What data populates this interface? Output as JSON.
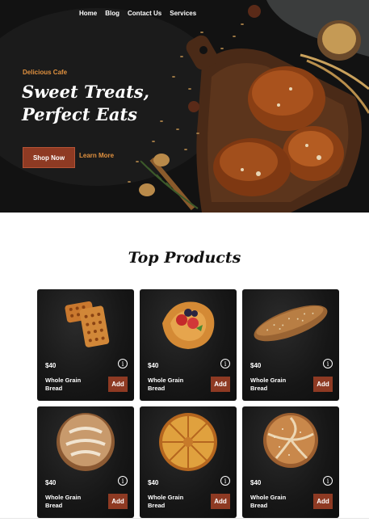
{
  "nav": {
    "items": [
      "Home",
      "Blog",
      "Contact Us",
      "Services"
    ]
  },
  "hero": {
    "eyebrow": "Delicious Cafe",
    "headline_line1": "Sweet Treats,",
    "headline_line2": "Perfect Eats",
    "primary_button": "Shop Now",
    "secondary_link": "Learn More"
  },
  "products": {
    "title": "Top Products",
    "items": [
      {
        "price": "$40",
        "name_line1": "Whole Grain",
        "name_line2": "Bread",
        "add_label": "Add",
        "image": "waffle-crackers"
      },
      {
        "price": "$40",
        "name_line1": "Whole Grain",
        "name_line2": "Bread",
        "add_label": "Add",
        "image": "berry-danish"
      },
      {
        "price": "$40",
        "name_line1": "Whole Grain",
        "name_line2": "Bread",
        "add_label": "Add",
        "image": "baguette-loaf"
      },
      {
        "price": "$40",
        "name_line1": "Whole Grain",
        "name_line2": "Bread",
        "add_label": "Add",
        "image": "round-country-loaf"
      },
      {
        "price": "$40",
        "name_line1": "Whole Grain",
        "name_line2": "Bread",
        "add_label": "Add",
        "image": "twisted-pie"
      },
      {
        "price": "$40",
        "name_line1": "Whole Grain",
        "name_line2": "Bread",
        "add_label": "Add",
        "image": "seeded-kaiser-roll"
      }
    ]
  },
  "colors": {
    "accent": "#8e3a23",
    "eyebrow": "#e0913f",
    "dark": "#151515"
  },
  "icons": {
    "info": "info-icon"
  }
}
